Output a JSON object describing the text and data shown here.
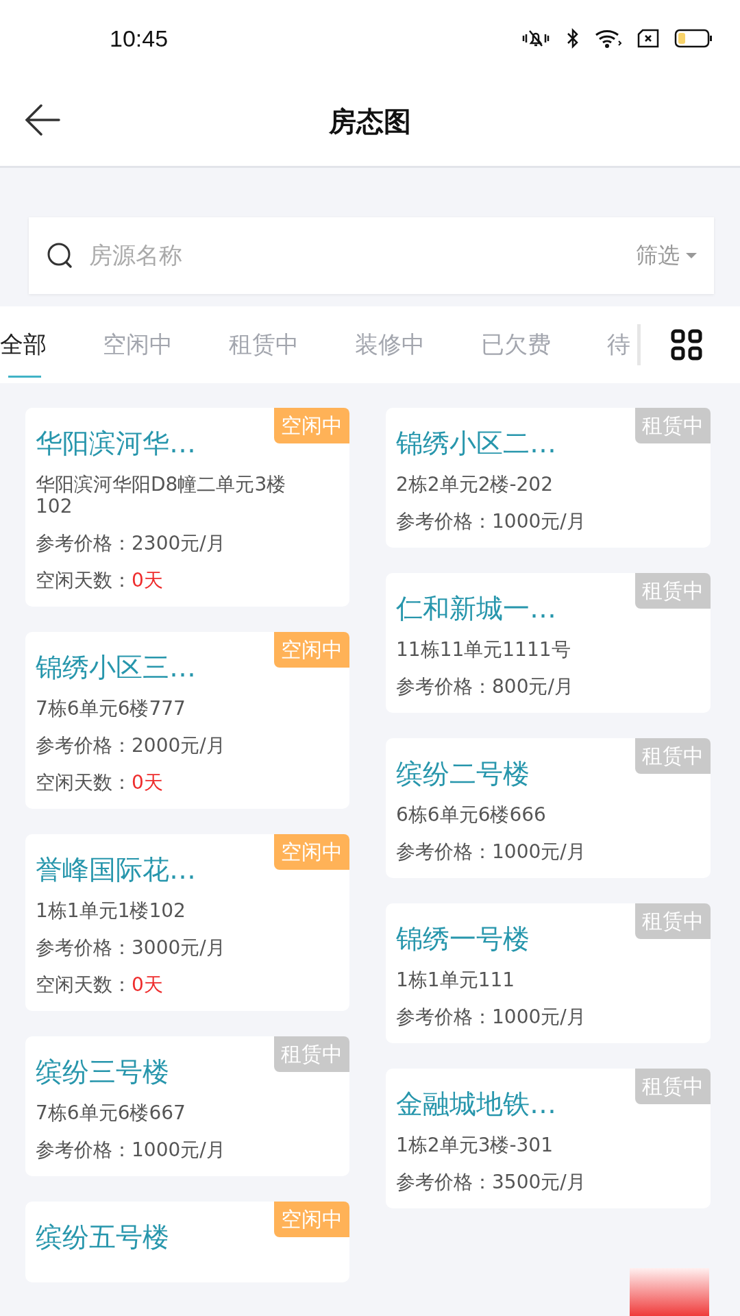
{
  "status_bar": {
    "time": "10:45"
  },
  "header": {
    "title": "房态图"
  },
  "search": {
    "placeholder": "房源名称",
    "filter": "筛选"
  },
  "tabs": [
    {
      "label": "全部",
      "selected": true
    },
    {
      "label": "空闲中",
      "selected": false
    },
    {
      "label": "租赁中",
      "selected": false
    },
    {
      "label": "装修中",
      "selected": false
    },
    {
      "label": "已欠费",
      "selected": false
    },
    {
      "label": "待",
      "selected": false
    }
  ],
  "columns": [
    {
      "cards": [
        {
          "title": "华阳滨河华…",
          "badge": {
            "label": "空闲中",
            "kind": "idle"
          },
          "address": "华阳滨河华阳D8幢二单元3楼102",
          "price": "参考价格：2300元/月",
          "idle_days": {
            "label": "空闲天数：",
            "value": "0天"
          }
        },
        {
          "title": "锦绣小区三…",
          "badge": {
            "label": "空闲中",
            "kind": "idle"
          },
          "address": "7栋6单元6楼777",
          "price": "参考价格：2000元/月",
          "idle_days": {
            "label": "空闲天数：",
            "value": "0天"
          }
        },
        {
          "title": "誉峰国际花…",
          "badge": {
            "label": "空闲中",
            "kind": "idle"
          },
          "address": "1栋1单元1楼102",
          "price": "参考价格：3000元/月",
          "idle_days": {
            "label": "空闲天数：",
            "value": "0天"
          }
        },
        {
          "title": "缤纷三号楼",
          "badge": {
            "label": "租赁中",
            "kind": "rented"
          },
          "address": "7栋6单元6楼667",
          "price": "参考价格：1000元/月"
        },
        {
          "title": "缤纷五号楼",
          "badge": {
            "label": "空闲中",
            "kind": "idle"
          }
        }
      ]
    },
    {
      "cards": [
        {
          "title": "锦绣小区二…",
          "badge": {
            "label": "租赁中",
            "kind": "rented"
          },
          "address": "2栋2单元2楼-202",
          "price": "参考价格：1000元/月"
        },
        {
          "title": "仁和新城一…",
          "badge": {
            "label": "租赁中",
            "kind": "rented"
          },
          "address": "11栋11单元1111号",
          "price": "参考价格：800元/月"
        },
        {
          "title": "缤纷二号楼",
          "badge": {
            "label": "租赁中",
            "kind": "rented"
          },
          "address": "6栋6单元6楼666",
          "price": "参考价格：1000元/月"
        },
        {
          "title": "锦绣一号楼",
          "badge": {
            "label": "租赁中",
            "kind": "rented"
          },
          "address": "1栋1单元111",
          "price": "参考价格：1000元/月"
        },
        {
          "title": "金融城地铁…",
          "badge": {
            "label": "租赁中",
            "kind": "rented"
          },
          "address": "1栋2单元3楼-301",
          "price": "参考价格：3500元/月"
        }
      ]
    }
  ]
}
